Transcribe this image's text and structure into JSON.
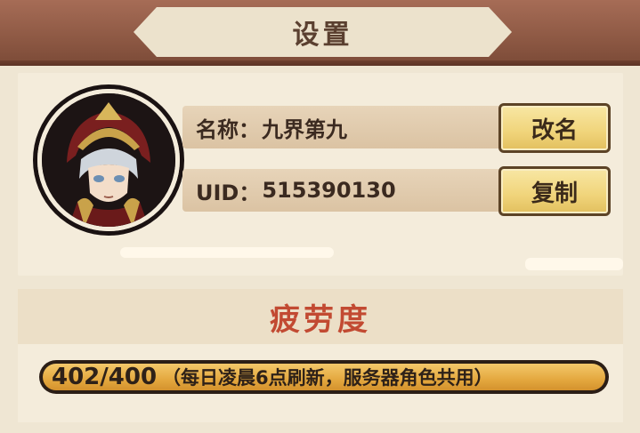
{
  "header": {
    "title": "设置"
  },
  "profile": {
    "name_label": "名称：",
    "name_value": "九界第九",
    "uid_label": "UID：",
    "uid_value": "515390130",
    "rename_label": "改名",
    "copy_label": "复制",
    "avatar_icon": "warrior-portrait-icon"
  },
  "fatigue": {
    "title": "疲劳度",
    "value": "402/400",
    "note": "（每日凌晨6点刷新，服务器角色共用）",
    "fill_fraction": 1.0
  },
  "colors": {
    "title_red": "#c24a32",
    "button_gold": "#f0d47a",
    "bar_fill": "#e4a83f",
    "band_brown": "#8f5a45"
  }
}
